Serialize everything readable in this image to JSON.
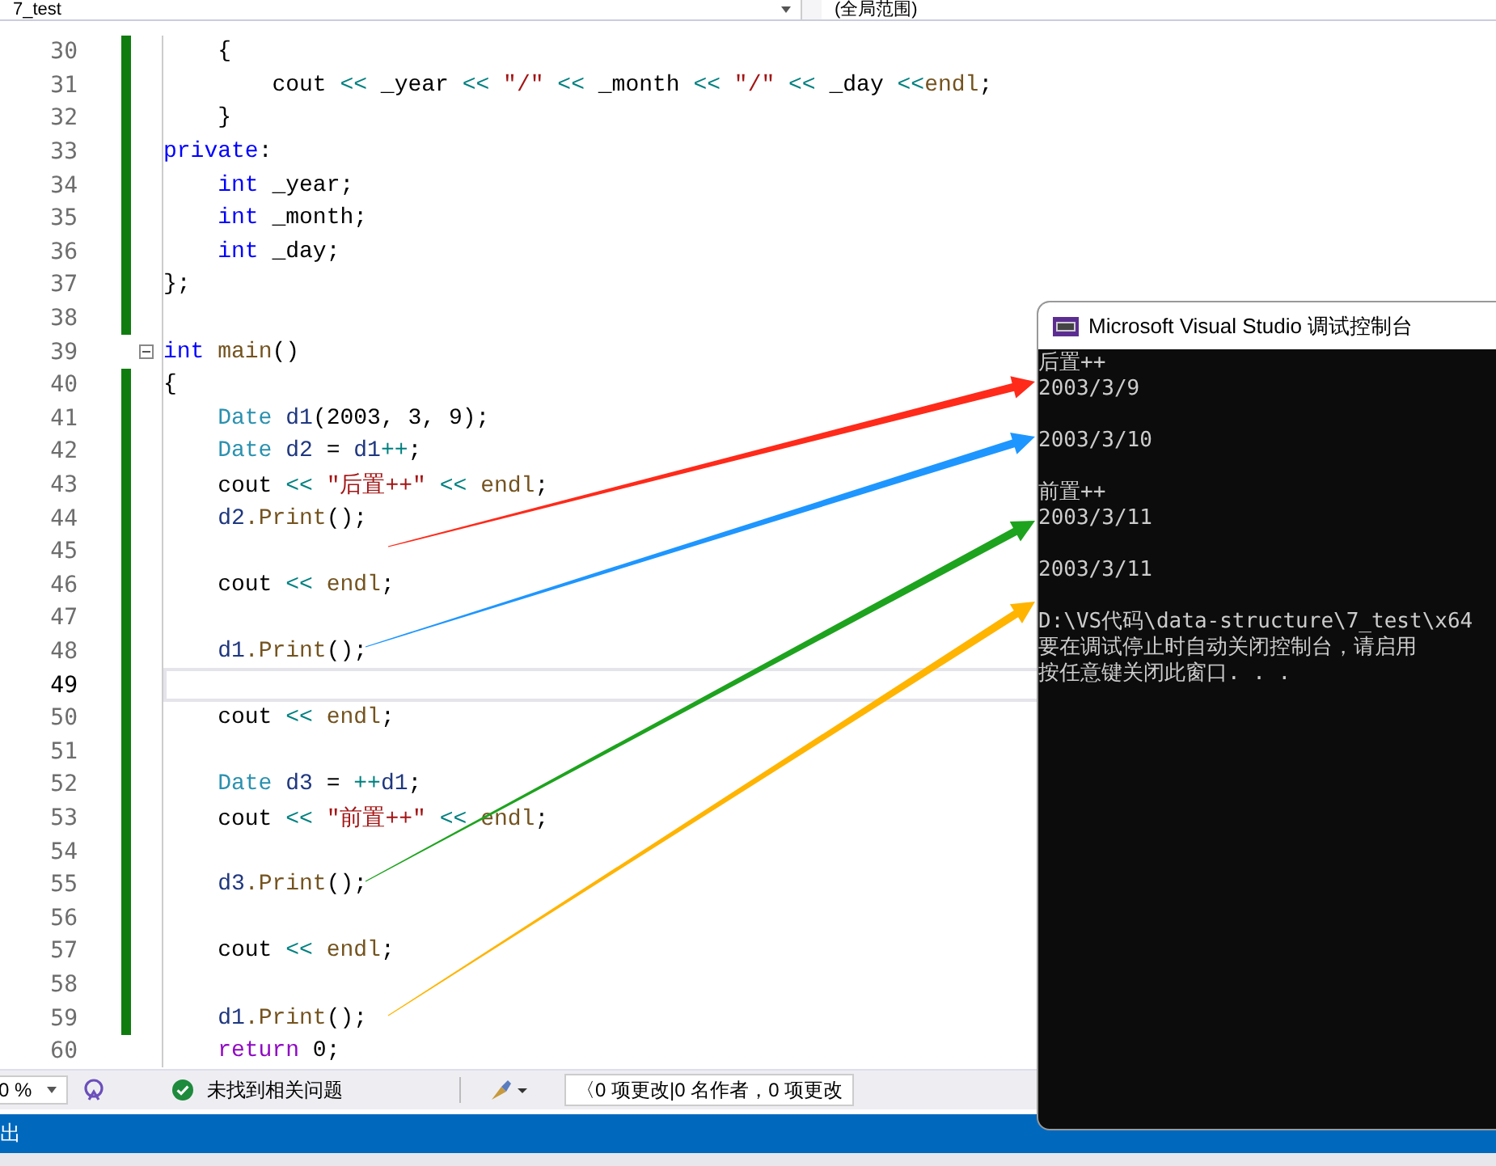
{
  "toolbar": {
    "project": "7_test",
    "scope": "(全局范围)"
  },
  "code_lines": [
    {
      "n": "30",
      "changed": true,
      "fold": false,
      "current": false,
      "code": [
        {
          "t": "    {",
          "color": "#000000"
        }
      ]
    },
    {
      "n": "31",
      "changed": true,
      "fold": false,
      "current": false,
      "code": [
        {
          "t": "        cout ",
          "color": "#000000"
        },
        {
          "t": "<<",
          "color": "#008080"
        },
        {
          "t": " _year ",
          "color": "#000000"
        },
        {
          "t": "<<",
          "color": "#008080"
        },
        {
          "t": " \"/\" ",
          "color": "#a31515"
        },
        {
          "t": "<<",
          "color": "#008080"
        },
        {
          "t": " _month ",
          "color": "#000000"
        },
        {
          "t": "<<",
          "color": "#008080"
        },
        {
          "t": " \"/\" ",
          "color": "#a31515"
        },
        {
          "t": "<<",
          "color": "#008080"
        },
        {
          "t": " _day ",
          "color": "#000000"
        },
        {
          "t": "<<",
          "color": "#008080"
        },
        {
          "t": "endl",
          "color": "#74531f"
        },
        {
          "t": ";",
          "color": "#000000"
        }
      ]
    },
    {
      "n": "32",
      "changed": true,
      "fold": false,
      "current": false,
      "code": [
        {
          "t": "    }",
          "color": "#000000"
        }
      ]
    },
    {
      "n": "33",
      "changed": true,
      "fold": false,
      "current": false,
      "code": [
        {
          "t": "private",
          "color": "#0000ff"
        },
        {
          "t": ":",
          "color": "#000000"
        }
      ]
    },
    {
      "n": "34",
      "changed": true,
      "fold": false,
      "current": false,
      "code": [
        {
          "t": "    int",
          "color": "#0000ff"
        },
        {
          "t": " _year;",
          "color": "#000000"
        }
      ]
    },
    {
      "n": "35",
      "changed": true,
      "fold": false,
      "current": false,
      "code": [
        {
          "t": "    int",
          "color": "#0000ff"
        },
        {
          "t": " _month;",
          "color": "#000000"
        }
      ]
    },
    {
      "n": "36",
      "changed": true,
      "fold": false,
      "current": false,
      "code": [
        {
          "t": "    int",
          "color": "#0000ff"
        },
        {
          "t": " _day;",
          "color": "#000000"
        }
      ]
    },
    {
      "n": "37",
      "changed": true,
      "fold": false,
      "current": false,
      "code": [
        {
          "t": "};",
          "color": "#000000"
        }
      ]
    },
    {
      "n": "38",
      "changed": true,
      "fold": false,
      "current": false
    },
    {
      "n": "39",
      "changed": false,
      "fold": true,
      "current": false,
      "code": [
        {
          "t": "int",
          "color": "#0000ff"
        },
        {
          "t": " main",
          "color": "#74531f"
        },
        {
          "t": "()",
          "color": "#000000"
        }
      ]
    },
    {
      "n": "40",
      "changed": true,
      "fold": false,
      "current": false,
      "code": [
        {
          "t": "{",
          "color": "#000000"
        }
      ]
    },
    {
      "n": "41",
      "changed": true,
      "fold": false,
      "current": false,
      "code": [
        {
          "t": "    Date",
          "color": "#2b91af"
        },
        {
          "t": " d1",
          "color": "#1f377f"
        },
        {
          "t": "(2003, 3, 9);",
          "color": "#000000"
        }
      ]
    },
    {
      "n": "42",
      "changed": true,
      "fold": false,
      "current": false,
      "code": [
        {
          "t": "    Date",
          "color": "#2b91af"
        },
        {
          "t": " d2",
          "color": "#1f377f"
        },
        {
          "t": " = ",
          "color": "#000000"
        },
        {
          "t": "d1",
          "color": "#1f377f"
        },
        {
          "t": "++",
          "color": "#008080"
        },
        {
          "t": ";",
          "color": "#000000"
        }
      ]
    },
    {
      "n": "43",
      "changed": true,
      "fold": false,
      "current": false,
      "code": [
        {
          "t": "    cout ",
          "color": "#000000"
        },
        {
          "t": "<<",
          "color": "#008080"
        },
        {
          "t": " \"后置++\" ",
          "color": "#a31515"
        },
        {
          "t": "<<",
          "color": "#008080"
        },
        {
          "t": " endl",
          "color": "#74531f"
        },
        {
          "t": ";",
          "color": "#000000"
        }
      ]
    },
    {
      "n": "44",
      "changed": true,
      "fold": false,
      "current": false,
      "code": [
        {
          "t": "    d2",
          "color": "#1f377f"
        },
        {
          "t": ".Print",
          "color": "#74531f"
        },
        {
          "t": "();",
          "color": "#000000"
        }
      ]
    },
    {
      "n": "45",
      "changed": true,
      "fold": false,
      "current": false
    },
    {
      "n": "46",
      "changed": true,
      "fold": false,
      "current": false,
      "code": [
        {
          "t": "    cout ",
          "color": "#000000"
        },
        {
          "t": "<<",
          "color": "#008080"
        },
        {
          "t": " endl",
          "color": "#74531f"
        },
        {
          "t": ";",
          "color": "#000000"
        }
      ]
    },
    {
      "n": "47",
      "changed": true,
      "fold": false,
      "current": false
    },
    {
      "n": "48",
      "changed": true,
      "fold": false,
      "current": false,
      "code": [
        {
          "t": "    d1",
          "color": "#1f377f"
        },
        {
          "t": ".Print",
          "color": "#74531f"
        },
        {
          "t": "();",
          "color": "#000000"
        }
      ]
    },
    {
      "n": "49",
      "changed": true,
      "fold": false,
      "current": true
    },
    {
      "n": "50",
      "changed": true,
      "fold": false,
      "current": false,
      "code": [
        {
          "t": "    cout ",
          "color": "#000000"
        },
        {
          "t": "<<",
          "color": "#008080"
        },
        {
          "t": " endl",
          "color": "#74531f"
        },
        {
          "t": ";",
          "color": "#000000"
        }
      ]
    },
    {
      "n": "51",
      "changed": true,
      "fold": false,
      "current": false
    },
    {
      "n": "52",
      "changed": true,
      "fold": false,
      "current": false,
      "code": [
        {
          "t": "    Date",
          "color": "#2b91af"
        },
        {
          "t": " d3",
          "color": "#1f377f"
        },
        {
          "t": " = ",
          "color": "#000000"
        },
        {
          "t": "++",
          "color": "#008080"
        },
        {
          "t": "d1",
          "color": "#1f377f"
        },
        {
          "t": ";",
          "color": "#000000"
        }
      ]
    },
    {
      "n": "53",
      "changed": true,
      "fold": false,
      "current": false,
      "code": [
        {
          "t": "    cout ",
          "color": "#000000"
        },
        {
          "t": "<<",
          "color": "#008080"
        },
        {
          "t": " \"前置++\" ",
          "color": "#a31515"
        },
        {
          "t": "<<",
          "color": "#008080"
        },
        {
          "t": " endl",
          "color": "#74531f"
        },
        {
          "t": ";",
          "color": "#000000"
        }
      ]
    },
    {
      "n": "54",
      "changed": true,
      "fold": false,
      "current": false
    },
    {
      "n": "55",
      "changed": true,
      "fold": false,
      "current": false,
      "code": [
        {
          "t": "    d3",
          "color": "#1f377f"
        },
        {
          "t": ".Print",
          "color": "#74531f"
        },
        {
          "t": "();",
          "color": "#000000"
        }
      ]
    },
    {
      "n": "56",
      "changed": true,
      "fold": false,
      "current": false
    },
    {
      "n": "57",
      "changed": true,
      "fold": false,
      "current": false,
      "code": [
        {
          "t": "    cout ",
          "color": "#000000"
        },
        {
          "t": "<<",
          "color": "#008080"
        },
        {
          "t": " endl",
          "color": "#74531f"
        },
        {
          "t": ";",
          "color": "#000000"
        }
      ]
    },
    {
      "n": "58",
      "changed": true,
      "fold": false,
      "current": false
    },
    {
      "n": "59",
      "changed": true,
      "fold": false,
      "current": false,
      "code": [
        {
          "t": "    d1",
          "color": "#1f377f"
        },
        {
          "t": ".Print",
          "color": "#74531f"
        },
        {
          "t": "();",
          "color": "#000000"
        }
      ]
    },
    {
      "n": "60",
      "changed": false,
      "fold": false,
      "current": false,
      "code": [
        {
          "t": "    return",
          "color": "#8f08c4"
        },
        {
          "t": " 0;",
          "color": "#000000"
        }
      ]
    }
  ],
  "status_bar": {
    "zoom": "0 %",
    "issues": "未找到相关问题",
    "changes": "〈0 项更改|0 名作者，0 项更改"
  },
  "bottom_panel": {
    "title": "出"
  },
  "console": {
    "title": "Microsoft Visual Studio 调试控制台",
    "blocks": [
      [
        "后置++",
        "2003/3/9"
      ],
      [
        "2003/3/10"
      ],
      [
        "前置++",
        "2003/3/11"
      ],
      [
        "2003/3/11"
      ],
      [
        "D:\\VS代码\\data-structure\\7_test\\x64",
        "要在调试停止时自动关闭控制台，请启用",
        "按任意键关闭此窗口. . ."
      ]
    ]
  },
  "arrows": [
    {
      "color": "#ff2a1a"
    },
    {
      "color": "#1e96ff"
    },
    {
      "color": "#1ea31e"
    },
    {
      "color": "#ffb400"
    }
  ]
}
